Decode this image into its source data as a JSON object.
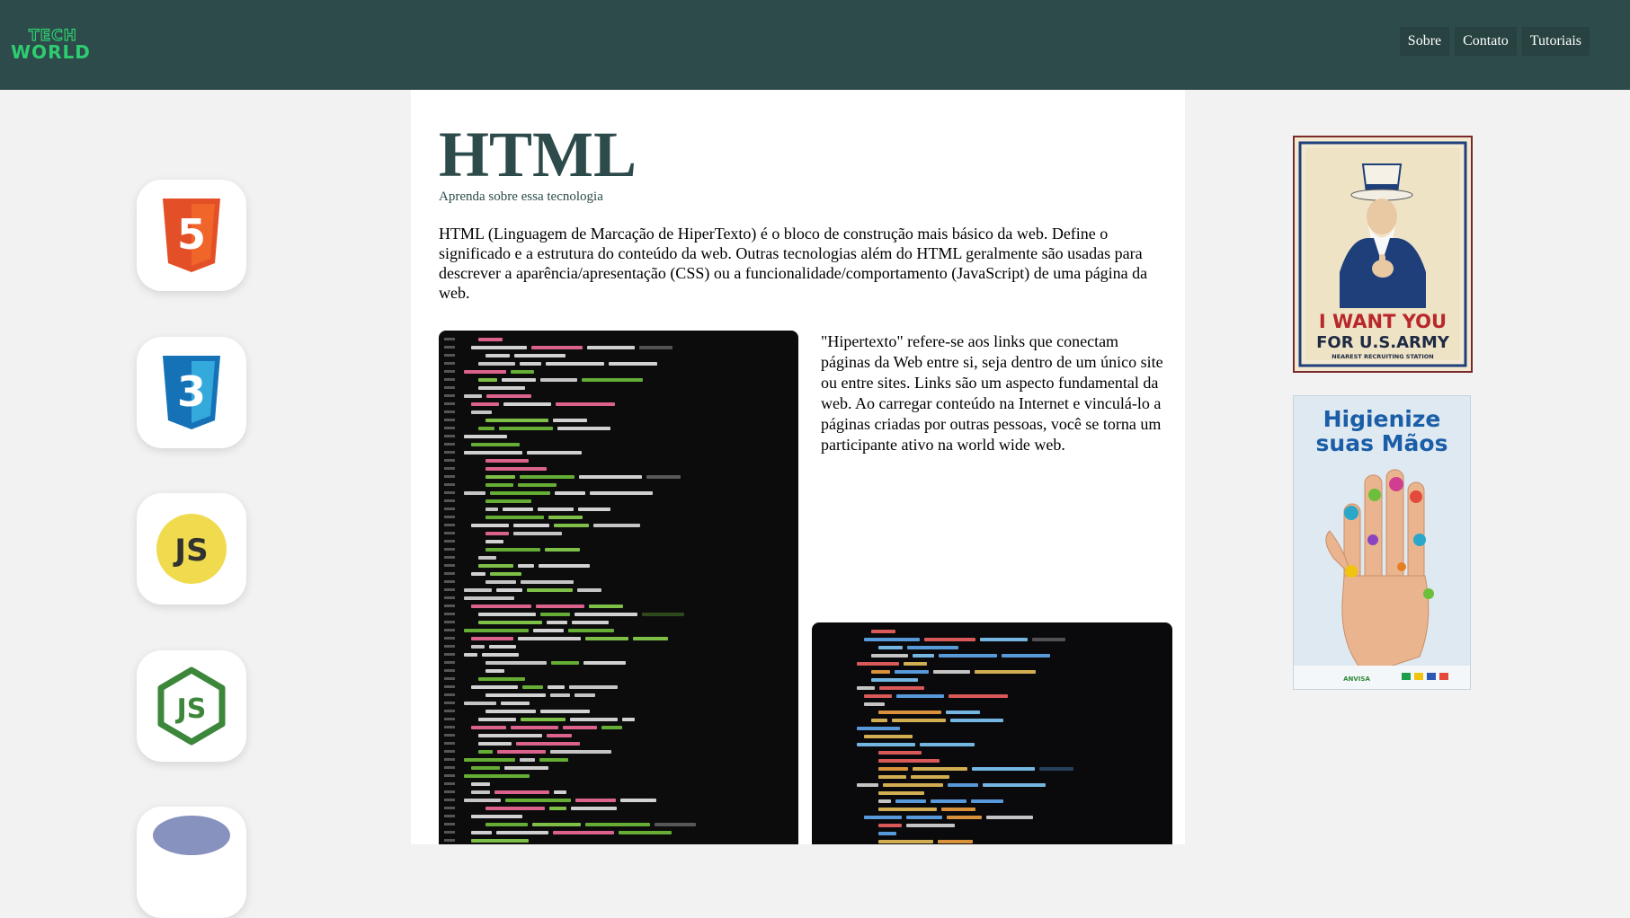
{
  "header": {
    "logo_top": "TECH",
    "logo_bottom": "WORLD",
    "nav": [
      {
        "label": "Sobre"
      },
      {
        "label": "Contato"
      },
      {
        "label": "Tutoriais"
      }
    ]
  },
  "sidebar": {
    "icons": [
      {
        "name": "html5-icon",
        "text": "5"
      },
      {
        "name": "css3-icon",
        "text": "3"
      },
      {
        "name": "javascript-icon",
        "text": "JS"
      },
      {
        "name": "nodejs-icon",
        "text": "JS"
      },
      {
        "name": "php-icon",
        "text": ""
      }
    ]
  },
  "main": {
    "title": "HTML",
    "subtitle": "Aprenda sobre essa tecnologia",
    "intro": "HTML (Linguagem de Marcação de HiperTexto) é o bloco de construção mais básico da web. Define o significado e a estrutura do conteúdo da web. Outras tecnologias além do HTML geralmente são usadas para descrever a aparência/apresentação (CSS) ou a funcionalidade/comportamento (JavaScript) de uma página da web.",
    "hypertext": "\"Hipertexto\" refere-se aos links que conectam páginas da Web entre si, seja dentro de um único site ou entre sites. Links são um aspecto fundamental da web. Ao carregar conteúdo na Internet e vinculá-lo a páginas criadas por outras pessoas, você se torna um participante ativo na world wide web."
  },
  "ads": {
    "army": {
      "line1": "I WANT YOU",
      "line2": "FOR U.S.ARMY",
      "line3": "NEAREST RECRUITING STATION"
    },
    "hands": {
      "line1": "Higienize",
      "line2": "suas Mãos",
      "footer": "ANVISA"
    }
  },
  "colors": {
    "header_bg": "#2d4b4a",
    "accent": "#2ecc71",
    "title": "#2d4b4a"
  }
}
